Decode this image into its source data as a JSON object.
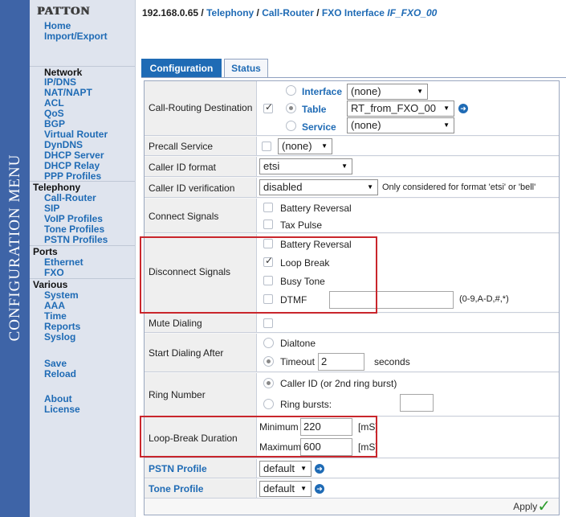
{
  "sidebar_vertical": "CONFIGURATION MENU",
  "logo": "PATTON",
  "breadcrumb": {
    "ip": "192.168.0.65",
    "sep": " / ",
    "p1": "Telephony",
    "p2": "Call-Router",
    "p3": "FXO Interface",
    "iface": "IF_FXO_00"
  },
  "nav": {
    "home": "Home",
    "import_export": "Import/Export",
    "network": "Network",
    "ipdns": "IP/DNS",
    "natnapt": "NAT/NAPT",
    "acl": "ACL",
    "qos": "QoS",
    "bgp": "BGP",
    "virtual_router": "Virtual Router",
    "dyndns": "DynDNS",
    "dhcp_server": "DHCP Server",
    "dhcp_relay": "DHCP Relay",
    "ppp_profiles": "PPP Profiles",
    "telephony": "Telephony",
    "call_router": "Call-Router",
    "sip": "SIP",
    "voip_profiles": "VoIP Profiles",
    "tone_profiles": "Tone Profiles",
    "pstn_profiles": "PSTN Profiles",
    "ports": "Ports",
    "ethernet": "Ethernet",
    "fxo": "FXO",
    "various": "Various",
    "system": "System",
    "aaa": "AAA",
    "time": "Time",
    "reports": "Reports",
    "syslog": "Syslog",
    "save": "Save",
    "reload": "Reload",
    "about": "About",
    "license": "License"
  },
  "tabs": {
    "configuration": "Configuration",
    "status": "Status"
  },
  "form": {
    "call_routing_destination": {
      "label": "Call-Routing Destination",
      "opt_interface": "Interface",
      "opt_table": "Table",
      "opt_service": "Service",
      "interface_value": "(none)",
      "table_value": "RT_from_FXO_00",
      "service_value": "(none)"
    },
    "precall_service": {
      "label": "Precall Service",
      "value": "(none)"
    },
    "caller_id_format": {
      "label": "Caller ID format",
      "value": "etsi"
    },
    "caller_id_verification": {
      "label": "Caller ID verification",
      "value": "disabled",
      "note": "Only considered for format 'etsi' or 'bell'"
    },
    "connect_signals": {
      "label": "Connect Signals",
      "opt1": "Battery Reversal",
      "opt2": "Tax Pulse"
    },
    "disconnect_signals": {
      "label": "Disconnect Signals",
      "opt1": "Battery Reversal",
      "opt2": "Loop Break",
      "opt3": "Busy Tone",
      "opt4": "DTMF",
      "dtmf_value": "",
      "dtmf_hint": "(0-9,A-D,#,*)"
    },
    "mute_dialing": {
      "label": "Mute Dialing"
    },
    "start_dialing_after": {
      "label": "Start Dialing After",
      "opt1": "Dialtone",
      "opt2": "Timeout",
      "timeout_value": "2",
      "unit": "seconds"
    },
    "ring_number": {
      "label": "Ring Number",
      "opt1": "Caller ID (or 2nd ring burst)",
      "opt2": "Ring bursts:",
      "bursts_value": ""
    },
    "loop_break_duration": {
      "label": "Loop-Break Duration",
      "min_label": "Minimum",
      "min_value": "220",
      "max_label": "Maximum",
      "max_value": "600",
      "unit": "[mS]"
    },
    "pstn_profile": {
      "label": "PSTN Profile",
      "value": "default"
    },
    "tone_profile": {
      "label": "Tone Profile",
      "value": "default"
    }
  },
  "apply_label": "Apply",
  "colors": {
    "accent": "#1f6bb5",
    "highlight": "#c9262c",
    "sidebar": "#3e64a7"
  }
}
